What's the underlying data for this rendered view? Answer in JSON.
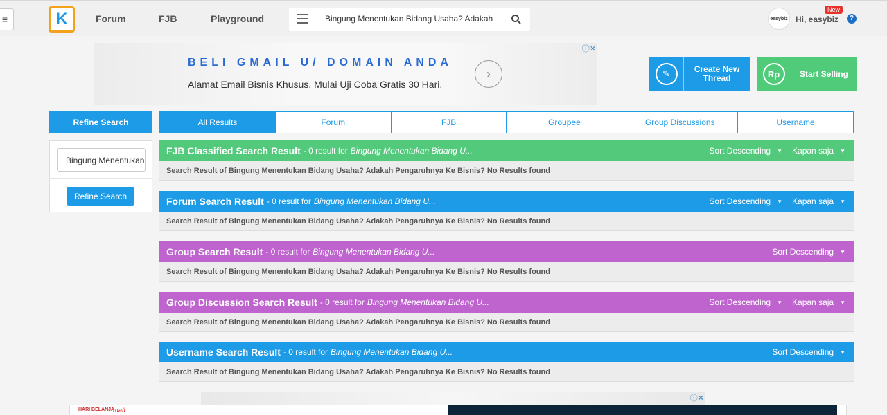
{
  "header": {
    "logo": "K",
    "nav": [
      "Forum",
      "FJB",
      "Playground"
    ],
    "search_value": "Bingung Menentukan Bidang Usaha? Adakah",
    "avatar_text": "easybiz",
    "greeting": "Hi, easybiz",
    "new_badge": "New",
    "help": "?"
  },
  "ad_top": {
    "headline": "BELI GMAIL U/ DOMAIN ANDA",
    "sub": "Alamat Email Bisnis Khusus. Mulai Uji Coba Gratis 30 Hari."
  },
  "cta": {
    "create_thread": "Create New Thread",
    "start_selling": "Start Selling",
    "rp": "Rp"
  },
  "refine": {
    "header": "Refine Search",
    "input_value": "Bingung Menentukan",
    "button": "Refine Search"
  },
  "tabs": [
    "All Results",
    "Forum",
    "FJB",
    "Groupee",
    "Group Discussions",
    "Username"
  ],
  "sections": [
    {
      "title": "FJB Classified Search Result",
      "meta": "- 0 result for",
      "query": "Bingung Menentukan Bidang U...",
      "sort": "Sort Descending",
      "time": "Kapan saja",
      "body": "Search Result of Bingung Menentukan Bidang Usaha? Adakah Pengaruhnya Ke Bisnis? No Results found",
      "color": "#52c97b"
    },
    {
      "title": "Forum Search Result",
      "meta": "- 0 result for",
      "query": "Bingung Menentukan Bidang U...",
      "sort": "Sort Descending",
      "time": "Kapan saja",
      "body": "Search Result of Bingung Menentukan Bidang Usaha? Adakah Pengaruhnya Ke Bisnis? No Results found",
      "color": "#1d9be6"
    },
    {
      "title": "Group Search Result",
      "meta": "- 0 result for",
      "query": "Bingung Menentukan Bidang U...",
      "sort": "Sort Descending",
      "time": "",
      "body": "Search Result of Bingung Menentukan Bidang Usaha? Adakah Pengaruhnya Ke Bisnis? No Results found",
      "color": "#bf63cf"
    },
    {
      "title": "Group Discussion Search Result",
      "meta": "- 0 result for",
      "query": "Bingung Menentukan Bidang U...",
      "sort": "Sort Descending",
      "time": "Kapan saja",
      "body": "Search Result of Bingung Menentukan Bidang Usaha? Adakah Pengaruhnya Ke Bisnis? No Results found",
      "color": "#bf63cf"
    },
    {
      "title": "Username Search Result",
      "meta": "- 0 result for",
      "query": "Bingung Menentukan Bidang U...",
      "sort": "Sort Descending",
      "time": "",
      "body": "Search Result of Bingung Menentukan Bidang Usaha? Adakah Pengaruhnya Ke Bisnis? No Results found",
      "color": "#1d9be6"
    }
  ],
  "ad_bottom": {
    "brand1": "HARI BELANJA",
    "brand2": "mall"
  }
}
